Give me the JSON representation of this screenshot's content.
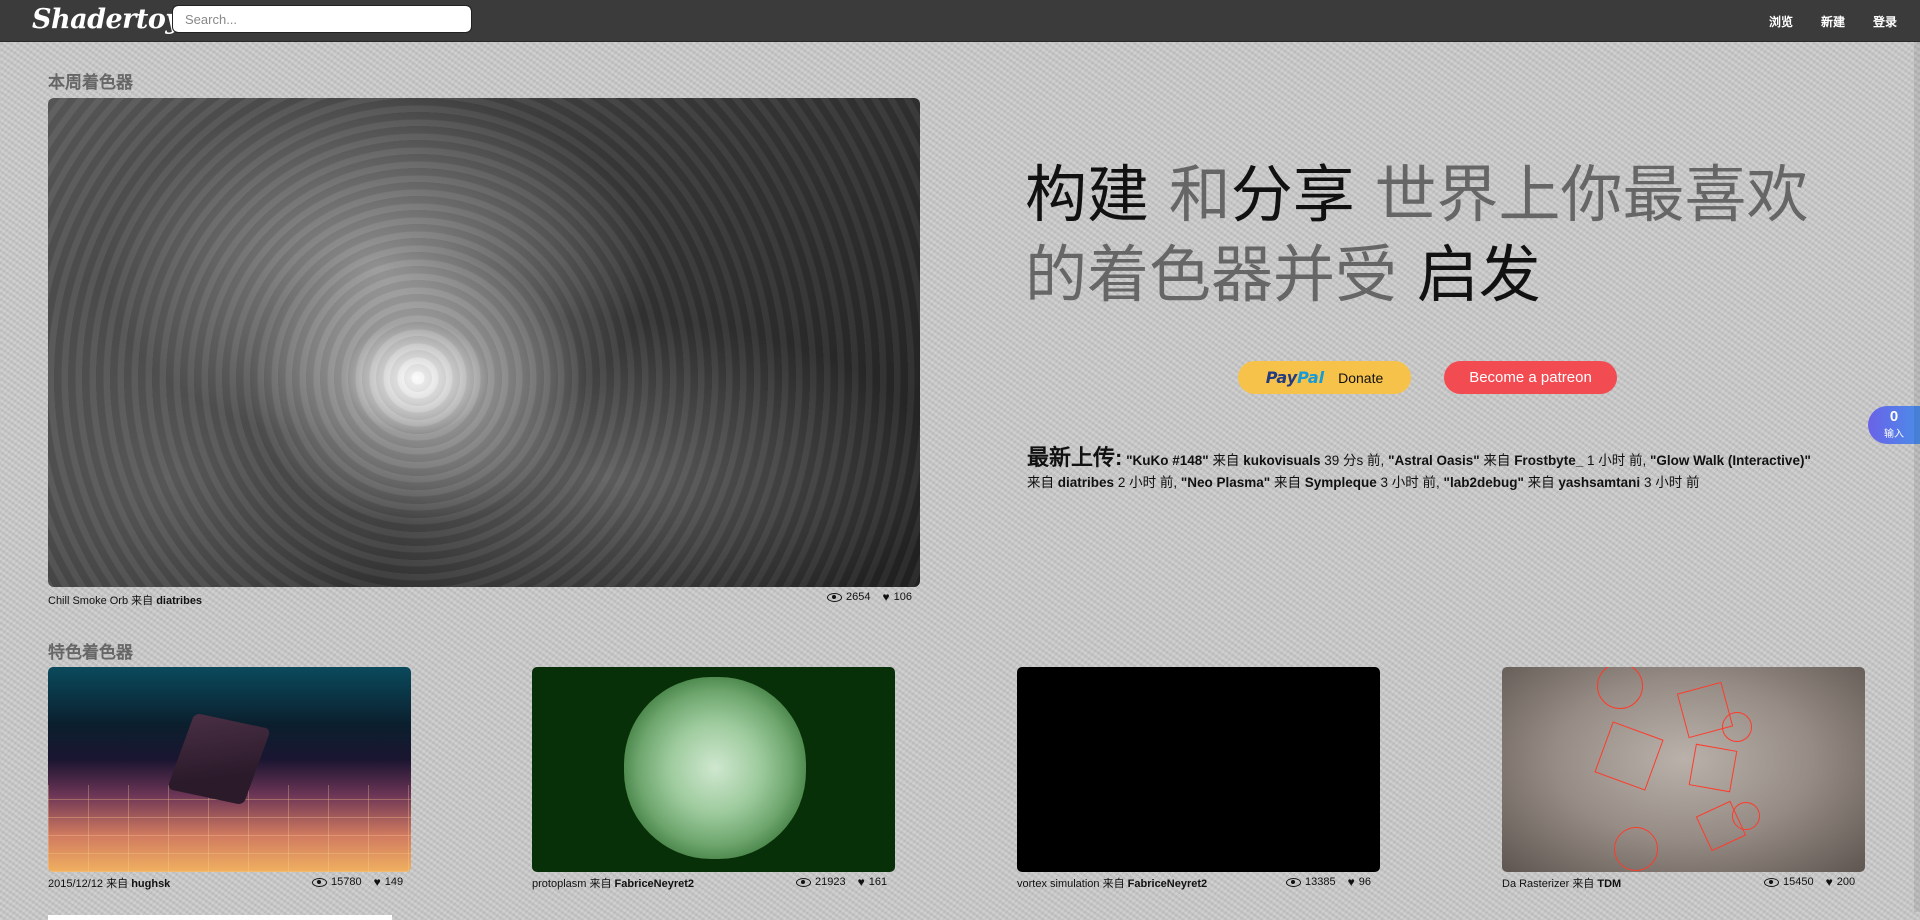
{
  "header": {
    "logo": "Shadertoy",
    "search_placeholder": "Search...",
    "nav": [
      "浏览",
      "新建",
      "登录"
    ]
  },
  "week": {
    "title": "本周着色器",
    "shader_name": "Chill Smoke Orb",
    "by": "来自",
    "author": "diatribes",
    "views": "2654",
    "likes": "106"
  },
  "hero": {
    "w1": "构建",
    "w2": "和",
    "w3": "分享",
    "w4": "世界上你最喜欢的着色器并受",
    "w5": "启发"
  },
  "donate": {
    "paypal_pay": "Pay",
    "paypal_pal": "Pal",
    "label": "Donate",
    "patreon": "Become a patreon"
  },
  "latest": {
    "label": "最新上传:",
    "items": [
      {
        "name": "\"KuKo #148\"",
        "by": "来自",
        "author": "kukovisuals",
        "time": "39 分s 前,"
      },
      {
        "name": "\"Astral Oasis\"",
        "by": "来自",
        "author": "Frostbyte_",
        "time": "1 小时 前,"
      },
      {
        "name": "\"Glow Walk (Interactive)\"",
        "by": "来自",
        "author": "diatribes",
        "time": "2 小时 前,"
      },
      {
        "name": "\"Neo Plasma\"",
        "by": "来自",
        "author": "Sympleque",
        "time": "3 小时 前,"
      },
      {
        "name": "\"lab2debug\"",
        "by": "来自",
        "author": "yashsamtani",
        "time": "3 小时 前"
      }
    ]
  },
  "featured": {
    "title": "特色着色器",
    "items": [
      {
        "name": "2015/12/12",
        "by": "来自",
        "author": "hughsk",
        "views": "15780",
        "likes": "149"
      },
      {
        "name": "protoplasm",
        "by": "来自",
        "author": "FabriceNeyret2",
        "views": "21923",
        "likes": "161"
      },
      {
        "name": "vortex simulation",
        "by": "来自",
        "author": "FabriceNeyret2",
        "views": "13385",
        "likes": "96"
      },
      {
        "name": "Da Rasterizer",
        "by": "来自",
        "author": "TDM",
        "views": "15450",
        "likes": "200"
      }
    ]
  },
  "widget": {
    "count": "0",
    "label": "输入"
  },
  "colors": {
    "topbar": "#3b3b3b",
    "paypal": "#f7c24a",
    "patreon": "#f24b52"
  }
}
